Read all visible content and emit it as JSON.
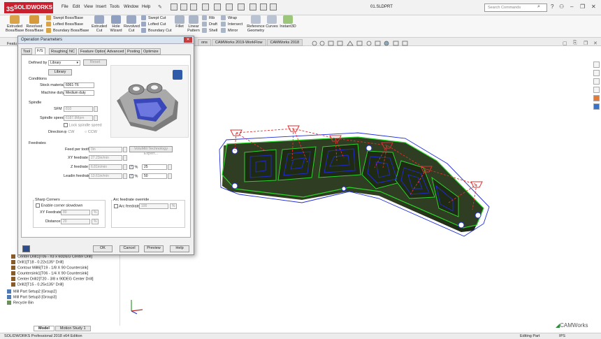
{
  "app": {
    "logo": "SOLIDWORKS",
    "document_title": "01.SLDPRT",
    "search_placeholder": "Search Commands"
  },
  "menu": [
    "File",
    "Edit",
    "View",
    "Insert",
    "Tools",
    "Window",
    "Help"
  ],
  "ribbon": {
    "extruded_boss": "Extruded Boss/Base",
    "revolved_boss": "Revolved Boss/Base",
    "swept_boss": "Swept Boss/Base",
    "lofted_boss": "Lofted Boss/Base",
    "boundary_boss": "Boundary Boss/Base",
    "extruded_cut": "Extruded Cut",
    "hole_wizard": "Hole Wizard",
    "revolved_cut": "Revolved Cut",
    "swept_cut": "Swept Cut",
    "lofted_cut": "Lofted Cut",
    "boundary_cut": "Boundary Cut",
    "fillet": "Fillet",
    "linear_pattern": "Linear Pattern",
    "rib": "Rib",
    "draft": "Draft",
    "shell": "Shell",
    "wrap": "Wrap",
    "intersect": "Intersect",
    "mirror": "Mirror",
    "reference_geometry": "Reference Geometry",
    "curves": "Curves",
    "instant3d": "Instant3D"
  },
  "viewport_tabs": [
    "ons",
    "CAMWorks 2019-WorkFlow",
    "CAMWorks 2018"
  ],
  "dialog": {
    "title": "Operation Parameters",
    "tabs": [
      "Tool",
      "F/S",
      "Roughing",
      "NC",
      "Feature Options",
      "Advanced",
      "Posting",
      "Optimize"
    ],
    "defined_by_label": "Defined by",
    "defined_by_value": "Library",
    "reset_button": "Reset",
    "library_button": "Library",
    "conditions_title": "Conditions",
    "stock_material_label": "Stock material",
    "stock_material_value": "6061-T6",
    "machine_duty_label": "Machine duty",
    "machine_duty_value": "Medium duty",
    "spindle_title": "Spindle",
    "sfm_label": "SFM",
    "sfm_value": "810",
    "spindle_speed_label": "Spindle speed",
    "spindle_speed_value": "6187.9Mpm",
    "lock_spindle_label": "Lock spindle speed",
    "direction_label": "Direction",
    "cw_label": "CW",
    "ccw_label": "CCW",
    "feedrates_title": "Feedrates",
    "feed_per_tooth_label": "Feed per tooth",
    "feed_per_tooth_value": "0in",
    "volumill_button": "VoluMill Technology Expert...",
    "xy_feedrate_label": "XY feedrate",
    "xy_feedrate_value": "27.23in/min",
    "z_feedrate_label": "Z feedrate",
    "z_feedrate_value": "6.81in/min",
    "z_pct": "25",
    "leadin_feedrate_label": "Leadin feedrate",
    "leadin_feedrate_value": "13.61in/min",
    "leadin_pct": "50",
    "pct_label": "%",
    "sharp_corners_title": "Sharp Corners",
    "enable_corner_label": "Enable corner slowdown",
    "sc_xy_feedrate_label": "XY Feedrate",
    "sc_xy_feedrate_value": "80",
    "sc_distance_label": "Distance",
    "sc_distance_value": "20",
    "arc_override_title": "Arc feedrate override",
    "arc_feedrate_label": "Arc feedrate",
    "arc_feedrate_value": "100",
    "ok_button": "OK",
    "cancel_button": "Cancel",
    "preview_button": "Preview",
    "help_button": "Help"
  },
  "tree_items": [
    "Center Drill1[T05 - #3 x 60DEG Center Drill]",
    "Drill1[T18 - 0.22x135° Drill]",
    "Contour Mill6[T19 - 1/8 X 90 Countersink]",
    "Countersink1[T06 - 1/4 X 90 Countersink]",
    "Center Drill2[T20 - 3/8 x 90DEG Center Drill]",
    "Drill2[T15 - 0.25x135° Drill]",
    "Mill Part Setup2 [Group2]",
    "Mill Part Setup3 [Group3]",
    "Recycle Bin"
  ],
  "bottom_tabs": [
    "Model",
    "Motion Study 1"
  ],
  "status": {
    "left": "SOLIDWORKS Professional 2018 x64 Edition",
    "mode": "Editing Part",
    "units": "IPS"
  },
  "camworks_logo": "CAMWorks",
  "colors": {
    "accent_red": "#c8202f",
    "toolpath_green": "#2bd32b",
    "toolpath_blue": "#1f2bd8",
    "rapid_red": "#e23030",
    "part_dark": "#2e3b22"
  }
}
